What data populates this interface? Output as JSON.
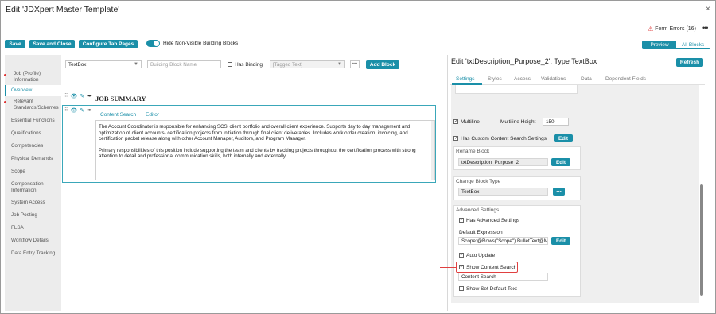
{
  "dialog": {
    "title": "Edit 'JDXpert Master Template'",
    "close_label": "×",
    "form_errors": "Form Errors (16)",
    "more_label": "•••"
  },
  "toolbar": {
    "save": "Save",
    "save_close": "Save and Close",
    "configure_tabs": "Configure Tab Pages",
    "hide_toggle_label": "Hide Non-Visible Building Blocks",
    "hide_toggle_on": true,
    "preview": "Preview",
    "all_blocks": "All Blocks"
  },
  "sidebar": {
    "items": [
      {
        "label": "Job (Profile) Information",
        "error": true
      },
      {
        "label": "Overview",
        "active": true
      },
      {
        "label": "Relevant Standards/Schemes",
        "error": true
      },
      {
        "label": "Essential Functions"
      },
      {
        "label": "Qualifications"
      },
      {
        "label": "Competencies"
      },
      {
        "label": "Physical Demands"
      },
      {
        "label": "Scope"
      },
      {
        "label": "Compensation Information"
      },
      {
        "label": "System Access"
      },
      {
        "label": "Job Posting"
      },
      {
        "label": "FLSA"
      },
      {
        "label": "Workflow Details"
      },
      {
        "label": "Data Entry Tracking"
      }
    ]
  },
  "builder": {
    "type_select": "TextBox",
    "name_placeholder": "Building Block Name",
    "has_binding": "Has Binding",
    "tagged_placeholder": "[Tagged Text]",
    "dots": "•••",
    "add_block": "Add Block",
    "section_heading": "JOB SUMMARY",
    "block_tabs": [
      "Content Search",
      "Editor"
    ],
    "paragraphs": [
      "The Account Coordinator is responsible for enhancing SCS' client portfolio and overall client experience. Supports day to day management and optimization of client accounts- certification projects from initiation through final client deliverables.  Includes work order creation, invoicing, and certification packet release along with other Account Manager, Auditors, and Program Manager.",
      "Primary responsibilities of this position include supporting the team and clients by tracking projects throughout the certification process with strong attention to detail and professional communication skills, both internally and externally."
    ]
  },
  "panel": {
    "title": "Edit 'txtDescription_Purpose_2', Type TextBox",
    "refresh": "Refresh",
    "tabs": [
      "Settings",
      "Styles",
      "Access",
      "Validations",
      "Data",
      "Dependent Fields"
    ],
    "active_tab": "Settings",
    "multiline": "Multiline",
    "multiline_checked": true,
    "multiline_height_label": "Multiline Height",
    "multiline_height": "150",
    "custom_search": "Has Custom Content Search Settings",
    "custom_search_checked": true,
    "edit": "Edit",
    "rename_title": "Rename Block",
    "rename_value": "txtDescription_Purpose_2",
    "change_type_title": "Change Block Type",
    "change_type_value": "TextBox",
    "change_type_btn": "•••",
    "advanced_title": "Advanced Settings",
    "has_advanced": "Has Advanced Settings",
    "has_advanced_checked": true,
    "default_expr_label": "Default Expression",
    "default_expr_value": "Scope:@Rows(\"Scope\").BulletText@M",
    "auto_update": "Auto Update",
    "auto_update_checked": true,
    "show_content_search": "Show Content Search",
    "show_content_search_checked": true,
    "content_search_value": "Content Search",
    "show_default_text": "Show Set Default Text",
    "show_default_text_checked": false
  },
  "colors": {
    "accent": "#1a8fa8",
    "error": "#e04040"
  }
}
